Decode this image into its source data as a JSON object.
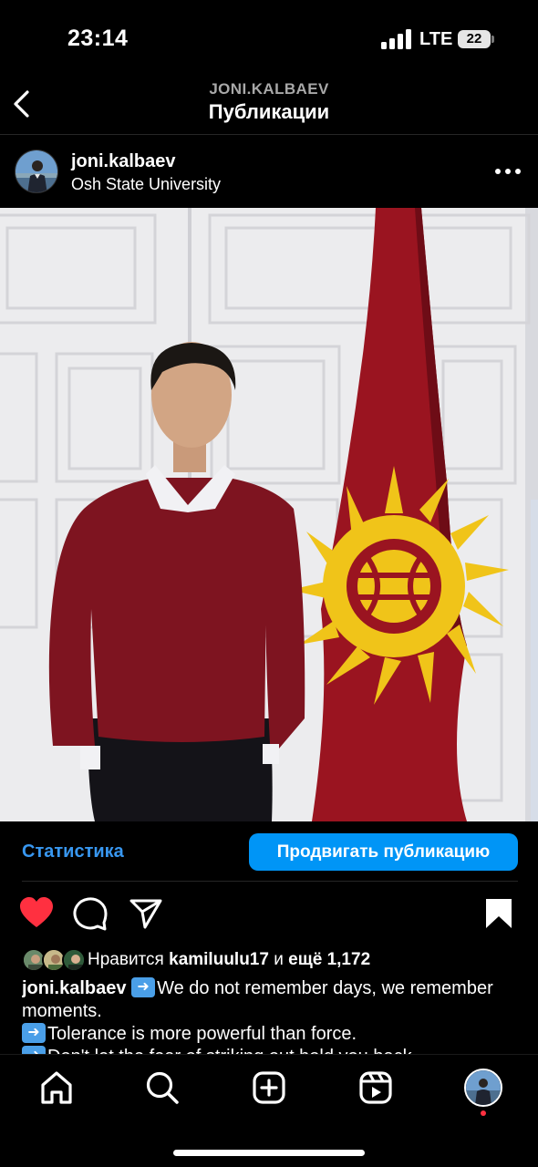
{
  "status_bar": {
    "time": "23:14",
    "network": "LTE",
    "battery": "22"
  },
  "header": {
    "kicker": "JONI.KALBAEV",
    "title": "Публикации"
  },
  "post": {
    "username": "joni.kalbaev",
    "location": "Osh State University",
    "insights_label": "Статистика",
    "boost_label": "Продвигать публикацию",
    "liked": true,
    "saved": true,
    "likes": {
      "prefix": "Нравится",
      "user": "kamiluulu17",
      "joiner": "и",
      "more": "ещё 1,172"
    },
    "caption": {
      "username": "joni.kalbaev",
      "line1": "We do not remember days, we remember moments.",
      "line2": "Tolerance is more powerful than force.",
      "line3": "Don't let the fear of striking out hold you back."
    }
  },
  "colors": {
    "accent": "#0095f6",
    "link": "#3897f0",
    "like": "#ff3040",
    "background": "#000000"
  },
  "icons": {
    "back": "chevron-left-icon",
    "more": "more-horizontal-icon",
    "like": "heart-filled-icon",
    "comment": "comment-icon",
    "share": "send-icon",
    "save": "bookmark-filled-icon",
    "home": "home-icon",
    "search": "search-icon",
    "create": "plus-square-icon",
    "reels": "reels-icon"
  }
}
